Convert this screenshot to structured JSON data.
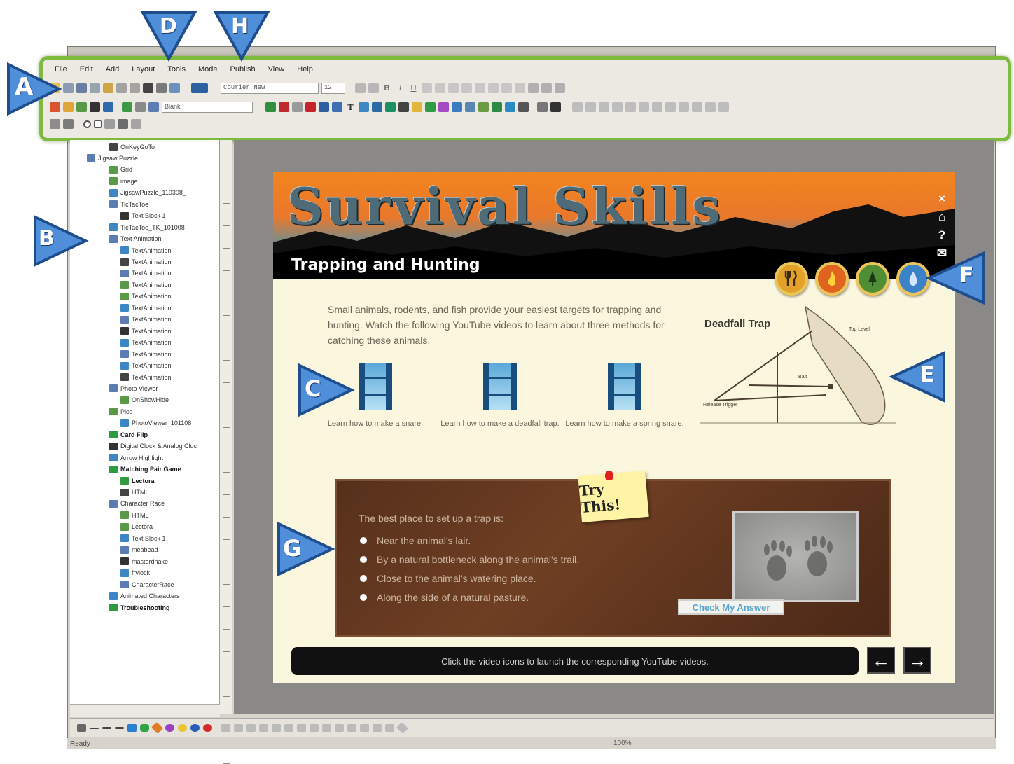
{
  "menu": [
    "File",
    "Edit",
    "Add",
    "Layout",
    "Tools",
    "Mode",
    "Publish",
    "View",
    "Help"
  ],
  "toolbar": {
    "font_name": "Courier New",
    "font_size": "12",
    "style_combo": "Blank",
    "bold": "B",
    "italic": "I",
    "underline": "U"
  },
  "tree": [
    {
      "label": "OnKeyGoTo",
      "bold": false
    },
    {
      "label": "Jigsaw Puzzle",
      "bold": false
    },
    {
      "label": "Grid",
      "bold": false
    },
    {
      "label": "image",
      "bold": false
    },
    {
      "label": "JigsawPuzzle_110308_",
      "bold": false
    },
    {
      "label": "TicTacToe",
      "bold": false
    },
    {
      "label": "Text Block 1",
      "bold": false
    },
    {
      "label": "TicTacToe_TK_101008",
      "bold": false
    },
    {
      "label": "Text Animation",
      "bold": false
    },
    {
      "label": "TextAnimation",
      "bold": false
    },
    {
      "label": "TextAnimation",
      "bold": false
    },
    {
      "label": "TextAnimation",
      "bold": false
    },
    {
      "label": "TextAnimation",
      "bold": false
    },
    {
      "label": "TextAnimation",
      "bold": false
    },
    {
      "label": "TextAnimation",
      "bold": false
    },
    {
      "label": "TextAnimation",
      "bold": false
    },
    {
      "label": "TextAnimation",
      "bold": false
    },
    {
      "label": "TextAnimation",
      "bold": false
    },
    {
      "label": "TextAnimation",
      "bold": false
    },
    {
      "label": "TextAnimation",
      "bold": false
    },
    {
      "label": "TextAnimation",
      "bold": false
    },
    {
      "label": "Photo Viewer",
      "bold": false
    },
    {
      "label": "OnShowHide",
      "bold": false
    },
    {
      "label": "Pics",
      "bold": false
    },
    {
      "label": "PhotoViewer_101108",
      "bold": false
    },
    {
      "label": "Card Flip",
      "bold": true
    },
    {
      "label": "Digital Clock & Analog Cloc",
      "bold": false
    },
    {
      "label": "Arrow Highlight",
      "bold": false
    },
    {
      "label": "Matching Pair Game",
      "bold": true
    },
    {
      "label": "Lectora",
      "bold": true
    },
    {
      "label": "HTML",
      "bold": false
    },
    {
      "label": "Character Race",
      "bold": false
    },
    {
      "label": "HTML",
      "bold": false
    },
    {
      "label": "Lectora",
      "bold": false
    },
    {
      "label": "Text Block 1",
      "bold": false
    },
    {
      "label": "meabead",
      "bold": false
    },
    {
      "label": "masterdhake",
      "bold": false
    },
    {
      "label": "frylock",
      "bold": false
    },
    {
      "label": "CharacterRace",
      "bold": false
    },
    {
      "label": "Animated Characters",
      "bold": false
    },
    {
      "label": "Troubleshooting",
      "bold": true
    }
  ],
  "page": {
    "banner_title": "Survival Skills",
    "section_title": "Trapping and Hunting",
    "side_nav": [
      "×",
      "⌂",
      "?",
      "✉"
    ],
    "intro_text": "Small animals, rodents, and fish provide your easiest targets for trapping and hunting. Watch the following YouTube videos to learn about three methods for catching these animals.",
    "videos": [
      {
        "caption": "Learn how to make a snare."
      },
      {
        "caption": "Learn how to make a deadfall trap."
      },
      {
        "caption": "Learn how to make a spring snare."
      }
    ],
    "trap_title": "Deadfall Trap",
    "trap_labels": [
      "Bait",
      "Release Trigger",
      "Top Level"
    ],
    "try_note": "Try This!",
    "question": "The best place to set up a trap is:",
    "answers": [
      "Near the animal's lair.",
      "By a natural bottleneck along the animal's trail.",
      "Close to the animal's watering place.",
      "Along the side of a natural pasture."
    ],
    "check_button": "Check My Answer",
    "footer_text": "Click the video icons to launch the corresponding YouTube videos.",
    "prev_arrow": "←",
    "next_arrow": "→"
  },
  "status": {
    "text": "Ready",
    "zoom": "100%"
  },
  "callouts": [
    "A",
    "B",
    "C",
    "D",
    "E",
    "F",
    "G",
    "H"
  ],
  "colors": {
    "callout_fill": "#4f8fd9",
    "toolbar_highlight": "#7dbb3c",
    "banner_orange": "#f2851e"
  }
}
